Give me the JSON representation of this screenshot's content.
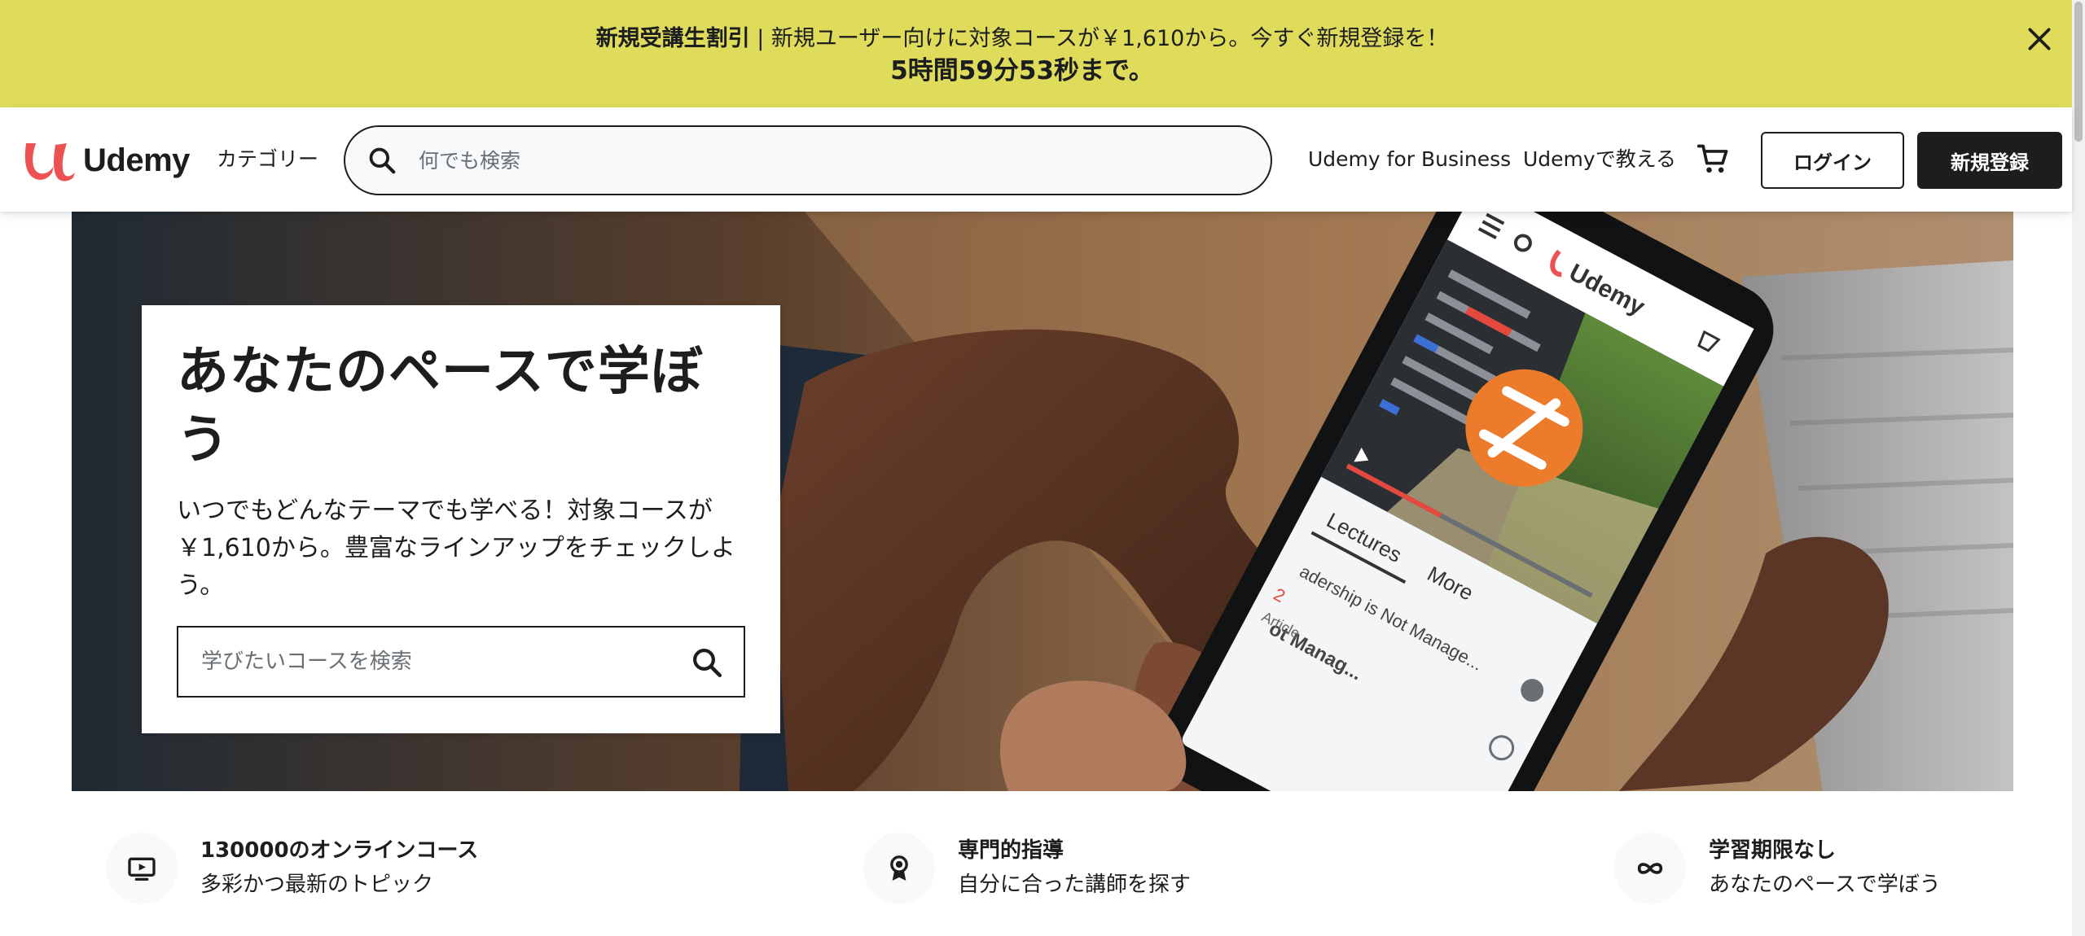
{
  "promo": {
    "bold_label": "新規受講生割引",
    "separator": " | ",
    "message": "新規ユーザー向けに対象コースが￥1,610から。今すぐ新規登録を！",
    "countdown": "5時間59分53秒まで。",
    "close_icon": "close-icon"
  },
  "header": {
    "logo_text": "Udemy",
    "categories_label": "カテゴリー",
    "search_placeholder": "何でも検索",
    "business_link": "Udemy for Business",
    "teach_link": "Udemyで教える",
    "login_label": "ログイン",
    "signup_label": "新規登録"
  },
  "hero": {
    "title": "あなたのペースで学ぼう",
    "description": "いつでもどんなテーマでも学べる！対象コースが￥1,610から。豊富なラインアップをチェックしよう。",
    "search_placeholder": "学びたいコースを検索",
    "phone_tabs": [
      "Lectures",
      "More"
    ],
    "phone_list": [
      "adership is Not Manage...",
      "ot Manag..."
    ],
    "phone_meta": [
      "2",
      "Article"
    ]
  },
  "features": [
    {
      "icon": "tv-play-icon",
      "title": "130000のオンラインコース",
      "subtitle": "多彩かつ最新のトピック"
    },
    {
      "icon": "award-ribbon-icon",
      "title": "専門的指導",
      "subtitle": "自分に合った講師を探す"
    },
    {
      "icon": "infinity-icon",
      "title": "学習期限なし",
      "subtitle": "あなたのペースで学ぼう"
    }
  ],
  "colors": {
    "promo_bg": "#dfdb5b",
    "brand_red": "#ec5252",
    "text_dark": "#1c1d1f",
    "placeholder_gray": "#6a6f73",
    "icon_bg": "#f7f9fa"
  }
}
